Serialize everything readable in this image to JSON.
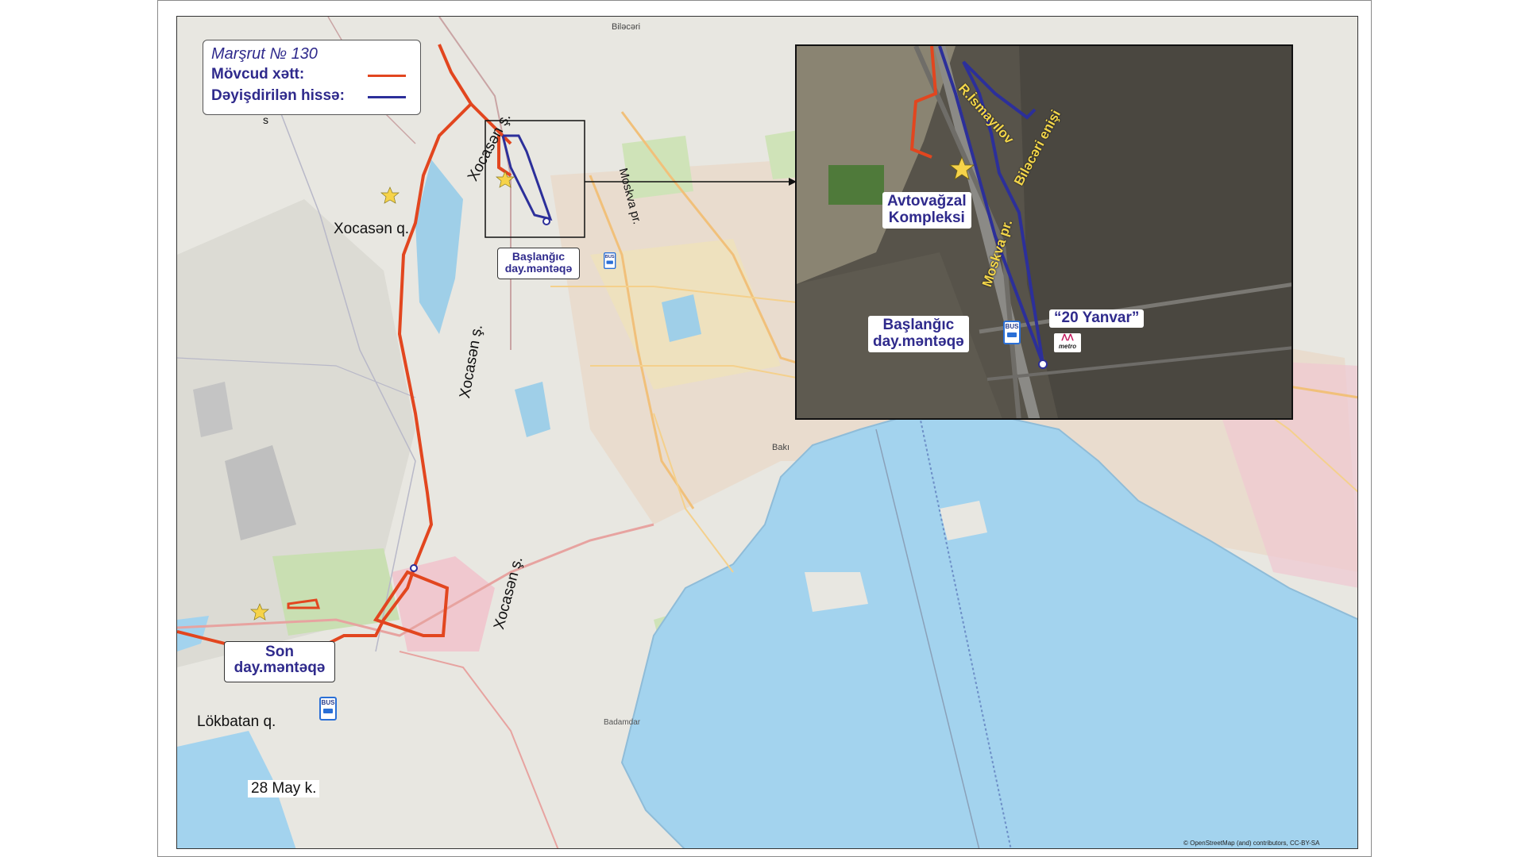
{
  "legend": {
    "title_prefix": "Marşrut №",
    "title_number": "130",
    "existing_label": "Mövcud xətt:",
    "existing_color": "#e2461f",
    "changed_label": "Dəyişdirilən hissə:",
    "changed_color": "#2c2f9a"
  },
  "map_labels": {
    "bilacari": "Biləcəri",
    "xocasen_q": "Xocasən q.",
    "lokbatan_q": "Lökbatan q.",
    "may28": "28 May k.",
    "s_mark": "s",
    "baki": "Bakı",
    "bibiheybet": "Badamdar",
    "xocasen_s1": "Xocasən ş.",
    "xocasen_s2": "Xocasən ş.",
    "xocasen_s3": "Xocasən ş.",
    "moskva_pr": "Moskva pr."
  },
  "callouts": {
    "start_line1": "Başlanğıc",
    "start_line2": "day.məntəqə",
    "end_line1": "Son",
    "end_line2": "day.məntəqə"
  },
  "inset": {
    "r_ismayilov": "R.İsmayılov",
    "bilacari_enisi": "Biləcəri enişi",
    "moskva_pr": "Moskva pr.",
    "avtovagzal_line1": "Avtovağzal",
    "avtovagzal_line2": "Kompleksi",
    "start_line1": "Başlanğıc",
    "start_line2": "day.məntəqə",
    "metro_station": "“20 Yanvar”",
    "metro_text": "metro"
  },
  "bus_icon_text": "BUS",
  "credit": "© OpenStreetMap (and) contributors, CC-BY-SA"
}
